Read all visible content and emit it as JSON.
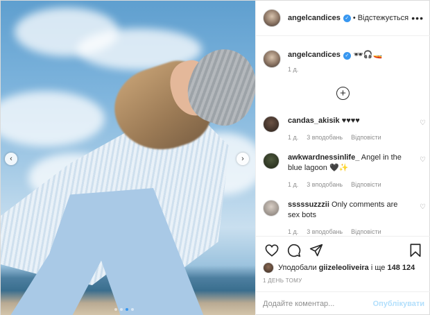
{
  "post": {
    "author": "angelcandices",
    "follow_status": "Відстежується",
    "separator": "•",
    "more_icon": "•••",
    "caption_emoji": "🕶🎧🚤",
    "caption_time": "1 д.",
    "carousel": {
      "prev_icon": "chevron-left-icon",
      "next_icon": "chevron-right-icon",
      "slide_count": 4,
      "active_slide": 2
    }
  },
  "comments": [
    {
      "user": "candas_akisik",
      "text": "♥♥♥♥",
      "time": "1 д.",
      "likes": "3 вподобань",
      "reply": "Відповісти"
    },
    {
      "user": "awkwardnessinlife_",
      "text": "Angel in the blue lagoon 🖤✨",
      "time": "1 д.",
      "likes": "3 вподобань",
      "reply": "Відповісти"
    },
    {
      "user": "sssssuzzzii",
      "text": "Only comments are sex bots",
      "time": "1 д.",
      "likes": "3 вподобань",
      "reply": "Відповісти"
    }
  ],
  "likes": {
    "prefix": "Уподобали",
    "user": "giizeleoliveira",
    "suffix": "і ще",
    "count": "148 124"
  },
  "date": "1 ДЕНЬ ТОМУ",
  "composer": {
    "placeholder": "Додайте коментар...",
    "publish": "Опублікувати"
  },
  "colors": {
    "accent": "#3897f0",
    "publish_disabled": "#b2dffc",
    "muted": "#8e8e8e"
  }
}
